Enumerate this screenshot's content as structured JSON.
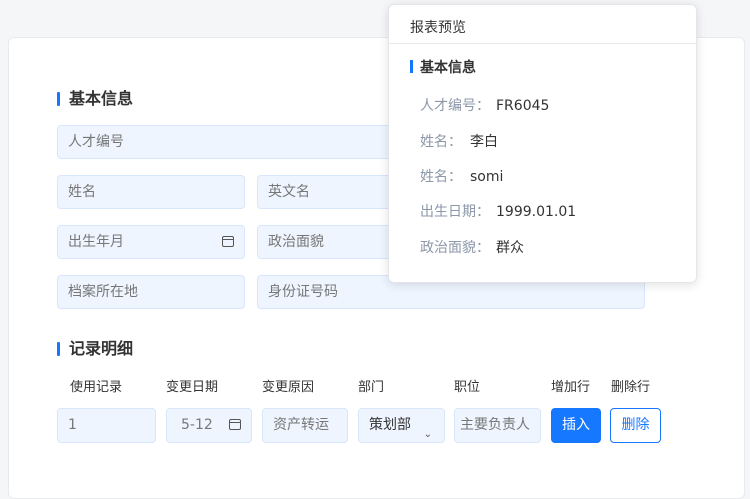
{
  "form": {
    "basic_title": "基本信息",
    "talent_no_placeholder": "人才编号",
    "name_placeholder": "姓名",
    "english_name_placeholder": "英文名",
    "birth_placeholder": "出生年月",
    "political_placeholder": "政治面貌",
    "archive_placeholder": "档案所在地",
    "id_placeholder": "身份证号码",
    "record_title": "记录明细",
    "columns": [
      "使用记录",
      "变更日期",
      "变更原因",
      "部门",
      "职位",
      "增加行",
      "删除行"
    ],
    "row": {
      "record": "1",
      "date": "5-12",
      "reason_placeholder": "资产转运",
      "department": "策划部",
      "position_placeholder": "主要负责人",
      "insert_label": "插入",
      "delete_label": "删除"
    }
  },
  "preview": {
    "title": "报表预览",
    "section": "基本信息",
    "rows": [
      {
        "key": "人才编号：",
        "value": "FR6045"
      },
      {
        "key": "姓名：",
        "value": "李白"
      },
      {
        "key": "姓名：",
        "value": "somi"
      },
      {
        "key": "出生日期：",
        "value": "1999.01.01"
      },
      {
        "key": "政治面貌：",
        "value": "群众"
      }
    ]
  },
  "colors": {
    "accent": "#1677ff",
    "field_bg": "#eef5ff"
  }
}
